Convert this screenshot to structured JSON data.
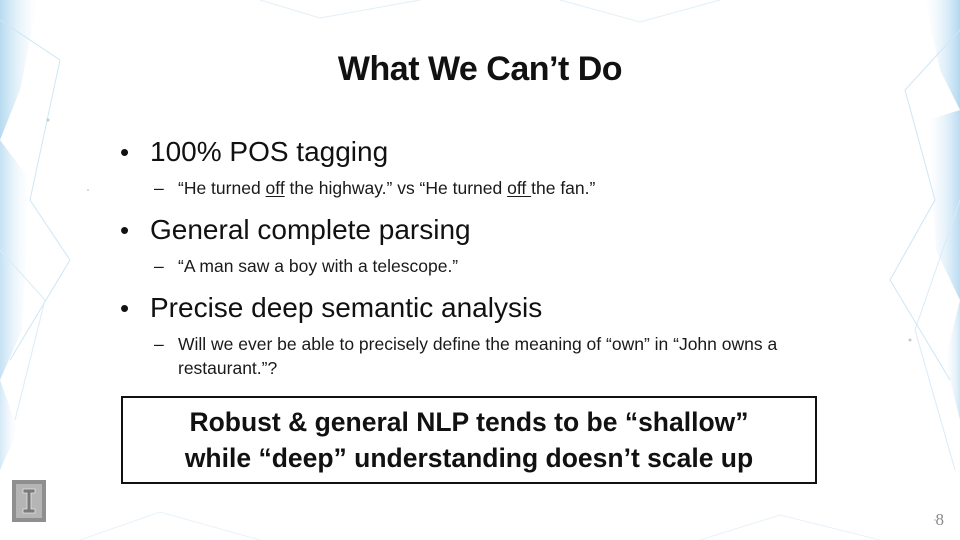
{
  "slide": {
    "title": "What We Can’t Do",
    "bullets": [
      {
        "text": "100% POS tagging",
        "sub": {
          "part1": "“He turned ",
          "u1": "off",
          "part2": " the highway.” vs “He turned ",
          "u2": "off ",
          "part3": "the fan.”"
        }
      },
      {
        "text": "General complete parsing",
        "sub": "“A man saw a boy with a telescope.”"
      },
      {
        "text": "Precise deep semantic analysis",
        "sub": "Will we ever be able to precisely define the meaning of “own”  in “John owns a restaurant.”?"
      }
    ],
    "callout": {
      "line1": "Robust  & general NLP tends to be “shallow”",
      "line2": "while “deep” understanding doesn’t scale up"
    },
    "page_number": "8"
  },
  "logo": {
    "icon": "university-block-i-logo",
    "glyph": "I"
  },
  "colors": {
    "background": "#ffffff",
    "text": "#111111",
    "accent_geometry": "#bcdcf0",
    "page_number": "#8a8a8a"
  }
}
